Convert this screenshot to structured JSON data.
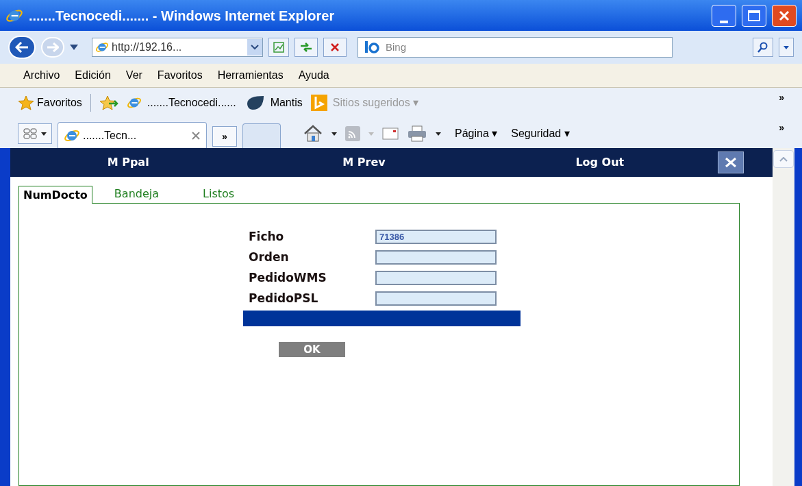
{
  "window": {
    "title": ".......Tecnocedi....... - Windows Internet Explorer"
  },
  "address_bar": {
    "url": "http://192.16...",
    "search_placeholder": "Bing"
  },
  "menu": [
    "Archivo",
    "Edición",
    "Ver",
    "Favoritos",
    "Herramientas",
    "Ayuda"
  ],
  "favorites_bar": {
    "label": "Favoritos",
    "links": [
      {
        "label": ".......Tecnocedi......",
        "kind": "page",
        "disabled": false
      },
      {
        "label": "Mantis",
        "kind": "mantis",
        "disabled": false
      },
      {
        "label": "Sitios sugeridos ▾",
        "kind": "bing",
        "disabled": true
      }
    ],
    "overflow": "»"
  },
  "browser_tabs": {
    "tabs": [
      {
        "label": ".......Tecn...",
        "selected": true
      }
    ],
    "overflow": "»"
  },
  "command_bar": {
    "items": [
      "Página ▾",
      "Seguridad ▾"
    ],
    "overflow": "»"
  },
  "page_nav": {
    "items": [
      "M Ppal",
      "M Prev",
      "Log Out"
    ]
  },
  "page_tabs": [
    {
      "label": "NumDocto",
      "selected": true
    },
    {
      "label": "Bandeja",
      "selected": false
    },
    {
      "label": "Listos",
      "selected": false
    }
  ],
  "form": {
    "fields": [
      {
        "label": "Ficho",
        "value": "71386"
      },
      {
        "label": "Orden"
      },
      {
        "label": "PedidoWMS"
      },
      {
        "label": "PedidoPSL"
      }
    ],
    "ok_button": "OK"
  }
}
